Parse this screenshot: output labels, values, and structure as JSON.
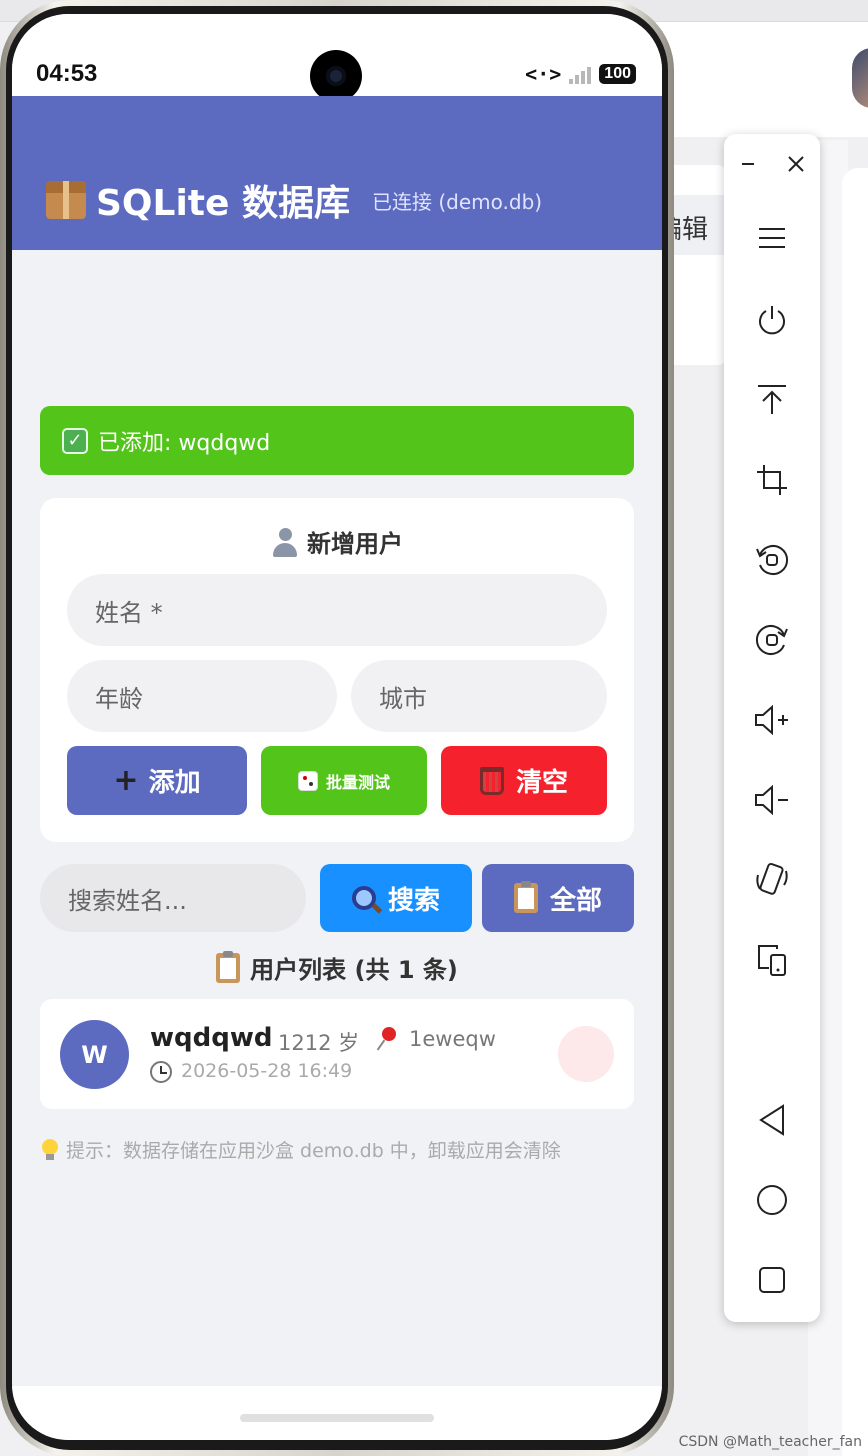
{
  "status_bar": {
    "time": "04:53",
    "battery": "100"
  },
  "header": {
    "title": "SQLite 数据库",
    "connection_status": "已连接 (demo.db)"
  },
  "toast": {
    "message": "已添加: wqdqwd"
  },
  "form": {
    "title": "新增用户",
    "name_placeholder": "姓名 *",
    "age_placeholder": "年龄",
    "city_placeholder": "城市",
    "add_label": "添加",
    "batch_label": "批量测试",
    "clear_label": "清空"
  },
  "search": {
    "placeholder": "搜索姓名...",
    "search_label": "搜索",
    "all_label": "全部"
  },
  "list": {
    "title": "用户列表 (共 1 条)",
    "rows": [
      {
        "initial": "W",
        "name": "wqdqwd",
        "age": "1212 岁",
        "city": "1eweqw",
        "created": "2026-05-28 16:49"
      }
    ]
  },
  "tip": "提示：数据存储在应用沙盒 demo.db 中，卸载应用会清除",
  "background": {
    "edit_text": "编辑",
    "watermark": "CSDN @Math_teacher_fan"
  },
  "colors": {
    "primary": "#5c6ac0",
    "success": "#52c41a",
    "danger": "#f5222d",
    "info": "#1890ff"
  },
  "toolbar_icons": [
    "minimize-icon",
    "close-icon",
    "menu-icon",
    "power-icon",
    "pin-top-icon",
    "crop-icon",
    "rotate-left-icon",
    "rotate-right-icon",
    "volume-up-icon",
    "volume-down-icon",
    "shake-icon",
    "multi-device-icon",
    "back-icon",
    "home-icon",
    "recents-icon"
  ]
}
